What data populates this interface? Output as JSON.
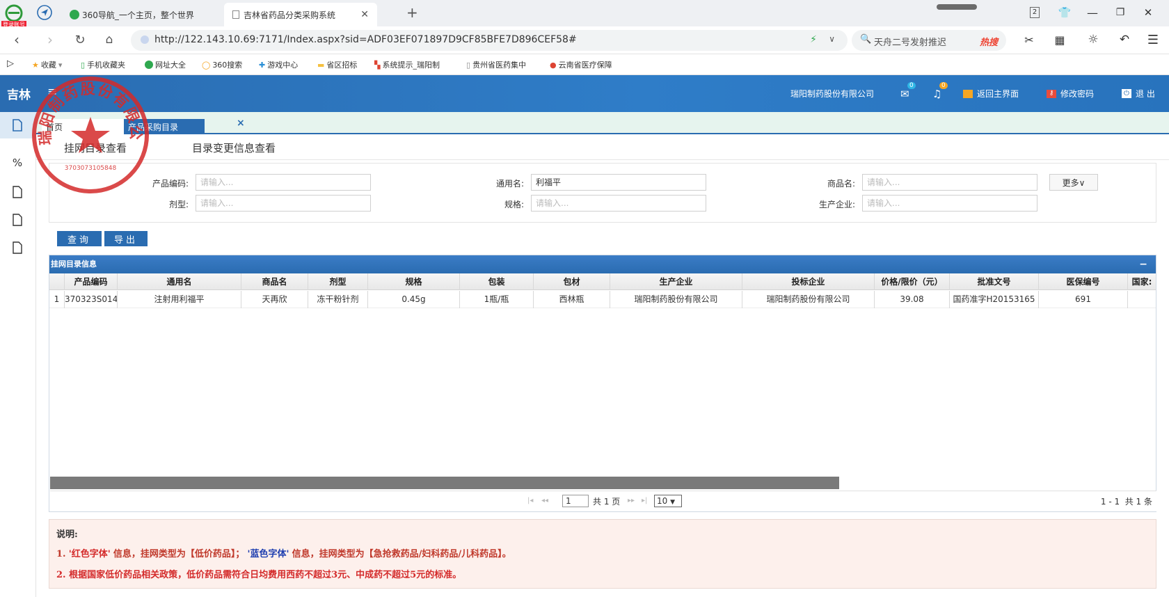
{
  "browser": {
    "badge": "登录账号",
    "tabs": [
      {
        "label": "360导航_一个主页，整个世界"
      },
      {
        "label": "吉林省药品分类采购系统"
      }
    ],
    "new_tab": "+",
    "tab_count": "2",
    "url": "http://122.143.10.69:7171/Index.aspx?sid=ADF03EF071897D9CF85BFE7D896CEF58#",
    "search_placeholder": "天舟二号发射推迟",
    "hot_label": "热搜",
    "bookmarks": [
      {
        "label": "收藏",
        "icon": "star-icon"
      },
      {
        "label": "手机收藏夹",
        "icon": "phone-icon"
      },
      {
        "label": "网址大全",
        "icon": "globe-icon"
      },
      {
        "label": "360搜索",
        "icon": "search-icon"
      },
      {
        "label": "游戏中心",
        "icon": "gamepad-icon"
      },
      {
        "label": "省区招标",
        "icon": "folder-icon"
      },
      {
        "label": "系统提示_瑞阳制",
        "icon": "system-icon"
      },
      {
        "label": "贵州省医药集中",
        "icon": "page-icon"
      },
      {
        "label": "云南省医疗保障",
        "icon": "emblem-icon"
      }
    ]
  },
  "app": {
    "province": "吉林",
    "company": "瑞阳制药股份有限公司",
    "mail_count": "0",
    "bell_count": "0",
    "back_label": "返回主界面",
    "password_label": "修改密码",
    "logout_label": "退 出",
    "page_tabs": [
      {
        "label": "首页"
      },
      {
        "label": "产品采购目录"
      }
    ],
    "tab_close": "×",
    "subnav": [
      {
        "label": "挂网目录查看"
      },
      {
        "label": "目录变更信息查看"
      }
    ]
  },
  "filters": {
    "product_code": {
      "label": "产品编码:",
      "placeholder": "请输入..."
    },
    "generic_name": {
      "label": "通用名:",
      "value": "利福平"
    },
    "trade_name": {
      "label": "商品名:",
      "placeholder": "请输入..."
    },
    "dosage_form": {
      "label": "剂型:",
      "placeholder": "请输入..."
    },
    "spec": {
      "label": "规格:",
      "placeholder": "请输入..."
    },
    "manufacturer": {
      "label": "生产企业:",
      "placeholder": "请输入..."
    },
    "more_label": "更多∨"
  },
  "actions": {
    "query": "查询",
    "export": "导出"
  },
  "grid": {
    "title": "挂网目录信息",
    "collapse": "−",
    "columns": [
      "产品编码",
      "通用名",
      "商品名",
      "剂型",
      "规格",
      "包装",
      "包材",
      "生产企业",
      "投标企业",
      "价格/限价（元）",
      "批准文号",
      "医保编号",
      "国家:"
    ],
    "rows": [
      {
        "index": "1",
        "cells": [
          "370323S014",
          "注射用利福平",
          "天再欣",
          "冻干粉针剂",
          "0.45g",
          "1瓶/瓶",
          "西林瓶",
          "瑞阳制药股份有限公司",
          "瑞阳制药股份有限公司",
          "39.08",
          "国药准字H20153165",
          "691",
          ""
        ]
      }
    ],
    "pager": {
      "page_value": "1",
      "total_pages": "共 1 页",
      "page_size": "10",
      "summary": "1 - 1  共 1 条"
    }
  },
  "notes": {
    "title": "说明:",
    "line1_prefix": "1.",
    "line1_red": "'红色字体'",
    "line1_mid": "信息，挂网类型为【低价药品】；",
    "line1_blue": "'蓝色字体'",
    "line1_end": "信息，挂网类型为【急抢救药品/妇科药品/儿科药品】。",
    "line2": "2. 根据国家低价药品相关政策，低价药品需符合日均费用西药不超过3元、中成药不超过5元的标准。"
  },
  "stamp": {
    "text": "瑞阳制药股份有限公司",
    "number": "3703073105848"
  },
  "colors": {
    "brand_blue": "#2a6cb1",
    "red": "#d42a2a",
    "note_bg": "#fdf0ec"
  }
}
